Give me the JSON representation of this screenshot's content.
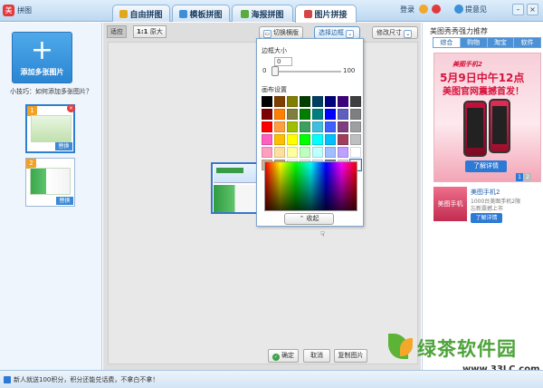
{
  "app": {
    "title": "拼图",
    "logo": "美"
  },
  "tabs": [
    {
      "label": "自由拼图",
      "color": "#e2a81d"
    },
    {
      "label": "模板拼图",
      "color": "#3d8fd8"
    },
    {
      "label": "海报拼图",
      "color": "#5aaa3d"
    },
    {
      "label": "图片拼接",
      "color": "#d64545"
    }
  ],
  "topright": {
    "login": "登录",
    "feedback": "提意见",
    "minimize": "–",
    "close": "×"
  },
  "left": {
    "add_plus": "+",
    "add_label": "添加多张图片",
    "tip": "小技巧：如何添加多张图片？",
    "thumbs": [
      {
        "num": "1",
        "replace": "替换",
        "delete": "×"
      },
      {
        "num": "2",
        "replace": "替换"
      }
    ]
  },
  "toolbar": {
    "fit": "适应",
    "actual_prefix": "1:1",
    "actual": "原大",
    "switch_layout": "切换横版",
    "select_border": "选择边框",
    "modify_size": "修改尺寸",
    "switch_icon": "▭",
    "select_icon": "⌄",
    "modify_icon": "⌄"
  },
  "popup": {
    "border_size_label": "边框大小",
    "border_value": "0",
    "slider_min": "0",
    "slider_max": "100",
    "slider_value": 0,
    "canvas_label": "画布设置",
    "collapse": "收起",
    "collapse_icon": "⌃",
    "swatches": [
      "#000000",
      "#7f3f00",
      "#7f7f00",
      "#003f00",
      "#003f5f",
      "#00007f",
      "#3f007f",
      "#3f3f3f",
      "#7f0000",
      "#ff7f00",
      "#7f7f3f",
      "#007f00",
      "#007f7f",
      "#0000ff",
      "#5f5fbf",
      "#7f7f7f",
      "#ff0000",
      "#ff9f3f",
      "#9fbf00",
      "#3f9f5f",
      "#3fbfdf",
      "#3f5fff",
      "#7f3f7f",
      "#9f9f9f",
      "#ff5fbf",
      "#ffbf00",
      "#ffff00",
      "#00ff00",
      "#00ffff",
      "#00bfff",
      "#9f3f5f",
      "#bfbfbf",
      "#ff9fbf",
      "#ffdf9f",
      "#ffff9f",
      "#bfffbf",
      "#bfffff",
      "#9fbfff",
      "#bf9fff",
      "#ffffff",
      "#d0b090",
      "#c0a080",
      "#ffffff",
      "#f0f0f0",
      "#e0ecf8",
      "#6f7f8f",
      "#dcdcdc",
      "#ffffff"
    ]
  },
  "bottom": {
    "confirm": "确定",
    "confirm_icon": "✓",
    "cancel": "取消",
    "copy": "复制图片"
  },
  "cursor": "☟",
  "right": {
    "title": "美图秀秀强力推荐",
    "tabs": [
      "综合",
      "购物",
      "淘宝",
      "软件"
    ],
    "active_tab": 0,
    "ad": {
      "line1": "美图手机2",
      "line2": "5月9日中午12点",
      "line3": "美图官网震撼首发！",
      "button": "了解详情",
      "pages": [
        "1",
        "2"
      ]
    },
    "item2": {
      "img_text": "美图手机 meitu",
      "title": "美图手机2",
      "desc1": "1000台美图手机2限",
      "desc2": "忘新震撼上市",
      "button": "了解详情"
    }
  },
  "brand": {
    "name": "绿茶软件园",
    "url": "www.33LC.com"
  },
  "status": {
    "text": "新人就送100积分，积分还能兑话费，不拿白不拿！"
  }
}
